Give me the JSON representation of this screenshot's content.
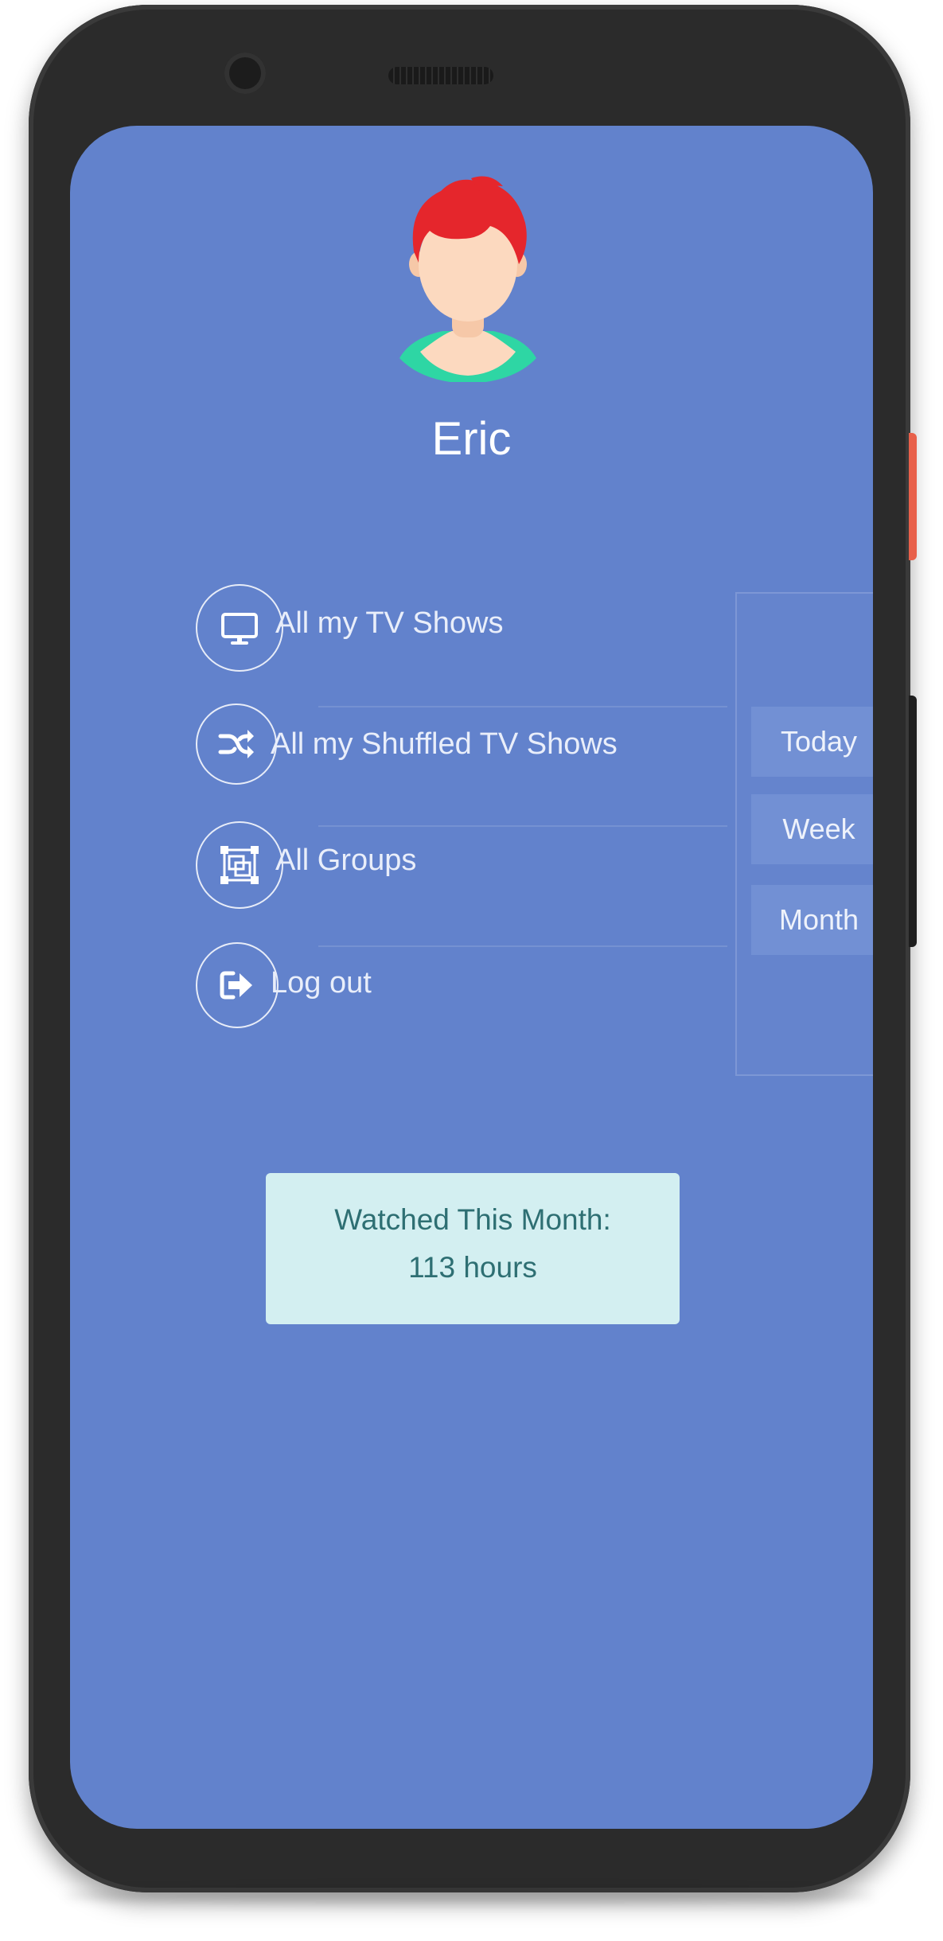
{
  "profile": {
    "name": "Eric",
    "avatar_icon": "user-avatar-red-hair"
  },
  "menu": {
    "items": [
      {
        "label": "All my TV Shows",
        "icon": "tv-icon"
      },
      {
        "label": "All my Shuffled TV Shows",
        "icon": "shuffle-icon"
      },
      {
        "label": "All Groups",
        "icon": "groups-icon"
      },
      {
        "label": "Log out",
        "icon": "logout-icon"
      }
    ]
  },
  "period_selector": {
    "buttons": [
      "Today",
      "Week",
      "Month"
    ]
  },
  "stats": {
    "line1": "Watched This Month:",
    "line2": "113 hours"
  },
  "colors": {
    "screen_background": "#6282cc",
    "stats_background": "#d3eff1",
    "stats_text": "#2e6f73",
    "avatar_hair": "#e5262c",
    "avatar_shirt": "#2ed6a4"
  }
}
